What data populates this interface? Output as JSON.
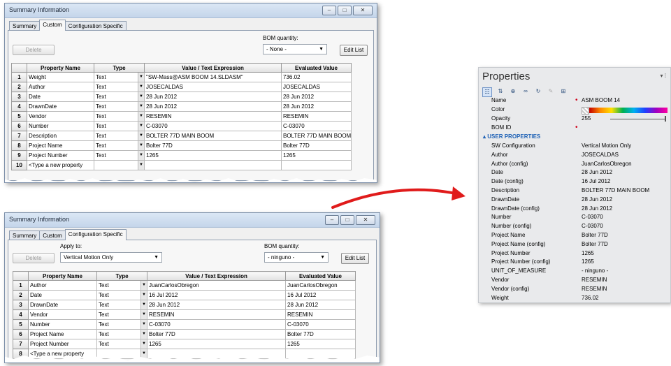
{
  "top_window": {
    "title": "Summary Information",
    "tabs": [
      "Summary",
      "Custom",
      "Configuration Specific"
    ],
    "active_tab": "Custom",
    "delete_label": "Delete",
    "bom_label": "BOM quantity:",
    "bom_value": "- None -",
    "edit_list_label": "Edit List",
    "columns": [
      "Property Name",
      "Type",
      "Value / Text Expression",
      "Evaluated Value"
    ],
    "rows": [
      {
        "num": "1",
        "name": "Weight",
        "type": "Text",
        "value": "\"SW-Mass@ASM BOOM 14.SLDASM\"",
        "evaluated": "736.02"
      },
      {
        "num": "2",
        "name": "Author",
        "type": "Text",
        "value": "JOSECALDAS",
        "evaluated": "JOSECALDAS"
      },
      {
        "num": "3",
        "name": "Date",
        "type": "Text",
        "value": "28 Jun 2012",
        "evaluated": "28 Jun 2012"
      },
      {
        "num": "4",
        "name": "DrawnDate",
        "type": "Text",
        "value": "28 Jun 2012",
        "evaluated": "28 Jun 2012"
      },
      {
        "num": "5",
        "name": "Vendor",
        "type": "Text",
        "value": "RESEMIN",
        "evaluated": "RESEMIN"
      },
      {
        "num": "6",
        "name": "Number",
        "type": "Text",
        "value": "C-03070",
        "evaluated": "C-03070"
      },
      {
        "num": "7",
        "name": "Description",
        "type": "Text",
        "value": "BOLTER 77D MAIN BOOM",
        "evaluated": "BOLTER 77D MAIN BOOM"
      },
      {
        "num": "8",
        "name": "Project Name",
        "type": "Text",
        "value": "Bolter 77D",
        "evaluated": "Bolter 77D"
      },
      {
        "num": "9",
        "name": "Project Number",
        "type": "Text",
        "value": "1265",
        "evaluated": "1265"
      },
      {
        "num": "10",
        "name": "<Type a new property",
        "type": "",
        "value": "",
        "evaluated": ""
      }
    ]
  },
  "bottom_window": {
    "title": "Summary Information",
    "tabs": [
      "Summary",
      "Custom",
      "Configuration Specific"
    ],
    "active_tab": "Configuration Specific",
    "apply_to_label": "Apply to:",
    "apply_to_value": "Vertical Motion Only",
    "delete_label": "Delete",
    "bom_label": "BOM quantity:",
    "bom_value": "- ninguno -",
    "edit_list_label": "Edit List",
    "columns": [
      "Property Name",
      "Type",
      "Value / Text Expression",
      "Evaluated Value"
    ],
    "rows": [
      {
        "num": "1",
        "name": "Author",
        "type": "Text",
        "value": "JuanCarlosObregon",
        "evaluated": "JuanCarlosObregon"
      },
      {
        "num": "2",
        "name": "Date",
        "type": "Text",
        "value": "16 Jul 2012",
        "evaluated": "16 Jul 2012"
      },
      {
        "num": "3",
        "name": "DrawnDate",
        "type": "Text",
        "value": "28 Jun 2012",
        "evaluated": "28 Jun 2012"
      },
      {
        "num": "4",
        "name": "Vendor",
        "type": "Text",
        "value": "RESEMIN",
        "evaluated": "RESEMIN"
      },
      {
        "num": "5",
        "name": "Number",
        "type": "Text",
        "value": "C-03070",
        "evaluated": "C-03070"
      },
      {
        "num": "6",
        "name": "Project Name",
        "type": "Text",
        "value": "Bolter 77D",
        "evaluated": "Bolter 77D"
      },
      {
        "num": "7",
        "name": "Project Number",
        "type": "Text",
        "value": "1265",
        "evaluated": "1265"
      },
      {
        "num": "8",
        "name": "<Type a new property",
        "type": "",
        "value": "",
        "evaluated": ""
      }
    ]
  },
  "properties": {
    "title": "Properties",
    "controls": "▾ ⁞",
    "name_label": "Name",
    "name_value": "ASM BOOM 14",
    "color_label": "Color",
    "opacity_label": "Opacity",
    "opacity_value": "255",
    "bom_id_label": "BOM ID",
    "section_label": "USER PROPERTIES",
    "items": [
      {
        "k": "SW Configuration",
        "v": "Vertical Motion Only"
      },
      {
        "k": "Author",
        "v": "JOSECALDAS"
      },
      {
        "k": "Author (config)",
        "v": "JuanCarlosObregon"
      },
      {
        "k": "Date",
        "v": "28 Jun 2012"
      },
      {
        "k": "Date (config)",
        "v": "16 Jul 2012"
      },
      {
        "k": "Description",
        "v": "BOLTER 77D MAIN BOOM"
      },
      {
        "k": "DrawnDate",
        "v": "28 Jun 2012"
      },
      {
        "k": "DrawnDate (config)",
        "v": "28 Jun 2012"
      },
      {
        "k": "Number",
        "v": "C-03070"
      },
      {
        "k": "Number (config)",
        "v": "C-03070"
      },
      {
        "k": "Project Name",
        "v": "Bolter 77D"
      },
      {
        "k": "Project Name (config)",
        "v": "Bolter 77D"
      },
      {
        "k": "Project Number",
        "v": "1265"
      },
      {
        "k": "Project Number (config)",
        "v": "1265"
      },
      {
        "k": "UNIT_OF_MEASURE",
        "v": "- ninguno -"
      },
      {
        "k": "Vendor",
        "v": "RESEMIN"
      },
      {
        "k": "Vendor (config)",
        "v": "RESEMIN"
      },
      {
        "k": "Weight",
        "v": "736.02"
      }
    ]
  },
  "colors": {
    "arrow": "#e01b1b",
    "section": "#1f62b6",
    "dot": "#d0021b"
  }
}
